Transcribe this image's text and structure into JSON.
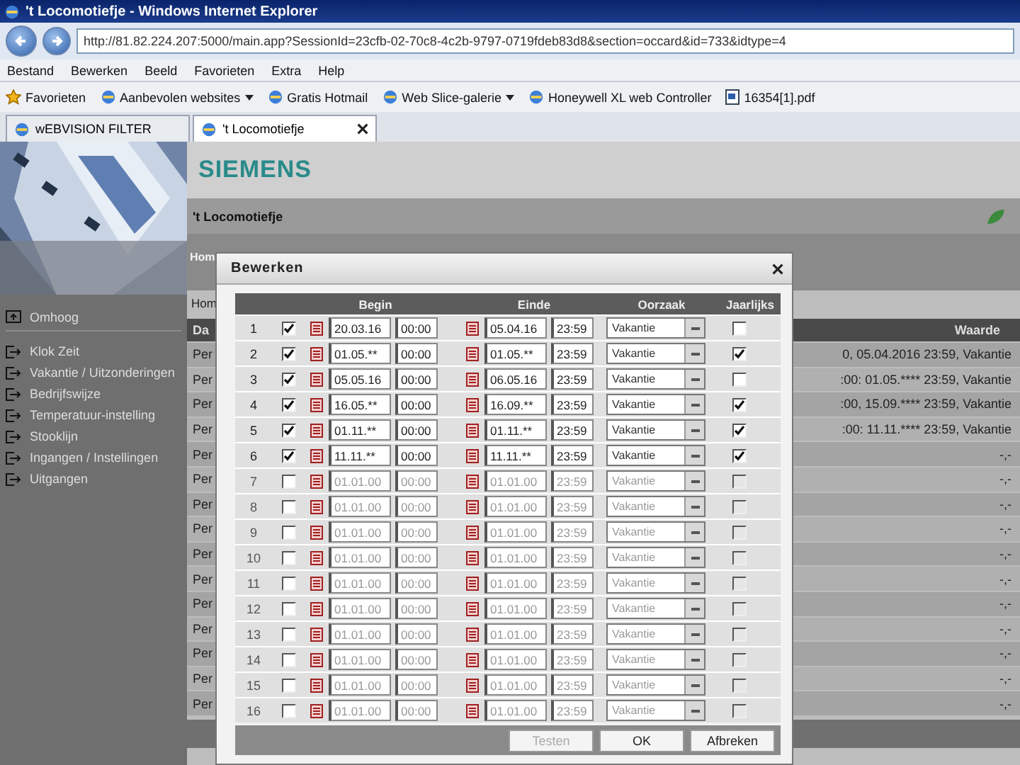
{
  "window": {
    "title": "'t Locomotiefje - Windows Internet Explorer"
  },
  "address": {
    "url": "http://81.82.224.207:5000/main.app?SessionId=23cfb-02-70c8-4c2b-9797-0719fdeb83d8&section=occard&id=733&idtype=4"
  },
  "menu": [
    "Bestand",
    "Bewerken",
    "Beeld",
    "Favorieten",
    "Extra",
    "Help"
  ],
  "favorites": {
    "label": "Favorieten",
    "links": [
      {
        "label": "Aanbevolen websites",
        "dropdown": true
      },
      {
        "label": "Gratis Hotmail",
        "dropdown": false
      },
      {
        "label": "Web Slice-galerie",
        "dropdown": true
      },
      {
        "label": "Honeywell XL web Controller",
        "dropdown": false
      },
      {
        "label": "16354[1].pdf",
        "dropdown": false
      }
    ]
  },
  "tabs": [
    {
      "label": "wEBVISION FILTER",
      "selected": false
    },
    {
      "label": "'t Locomotiefje",
      "selected": true
    }
  ],
  "page": {
    "logo": "SIEMENS",
    "site_title": "'t Locomotiefje",
    "breadcrumb": "Hom",
    "heading": "Hom",
    "sidebar": [
      {
        "kind": "up",
        "label": "Omhoog"
      },
      {
        "kind": "link",
        "label": "Klok Zeit"
      },
      {
        "kind": "link",
        "label": "Vakantie / Uitzonderingen"
      },
      {
        "kind": "link",
        "label": "Bedrijfswijze"
      },
      {
        "kind": "link",
        "label": "Temperatuur-instelling"
      },
      {
        "kind": "link",
        "label": "Stooklijn"
      },
      {
        "kind": "link",
        "label": "Ingangen / Instellingen"
      },
      {
        "kind": "link",
        "label": "Uitgangen"
      }
    ],
    "table": {
      "columns": [
        "Da",
        "Waarde"
      ],
      "rows": [
        {
          "column_1": "Per",
          "waarde": "0, 05.04.2016 23:59, Vakantie"
        },
        {
          "column_1": "Per",
          "waarde": ":00: 01.05.**** 23:59, Vakantie"
        },
        {
          "column_1": "Per",
          "waarde": ":00, 15.09.**** 23:59, Vakantie"
        },
        {
          "column_1": "Per",
          "waarde": ":00: 11.11.**** 23:59, Vakantie"
        },
        {
          "column_1": "Per",
          "waarde": "-,-"
        },
        {
          "column_1": "Per",
          "waarde": "-,-"
        },
        {
          "column_1": "Per",
          "waarde": "-,-"
        },
        {
          "column_1": "Per",
          "waarde": "-,-"
        },
        {
          "column_1": "Per",
          "waarde": "-,-"
        },
        {
          "column_1": "Per",
          "waarde": "-,-"
        },
        {
          "column_1": "Per",
          "waarde": "-,-"
        },
        {
          "column_1": "Per",
          "waarde": "-,-"
        },
        {
          "column_1": "Per",
          "waarde": "-,-"
        },
        {
          "column_1": "Per",
          "waarde": "-,-"
        },
        {
          "column_1": "Per",
          "waarde": "-,-"
        }
      ]
    }
  },
  "dialog": {
    "title": "Bewerken",
    "columns": [
      "Begin",
      "Einde",
      "Oorzaak",
      "Jaarlijks"
    ],
    "rows": [
      {
        "number": "1",
        "active": true,
        "begin_date": "20.03.16",
        "begin_time": "00:00",
        "end_date": "05.04.16",
        "end_time": "23:59",
        "reason": "Vakantie",
        "yearly": false
      },
      {
        "number": "2",
        "active": true,
        "begin_date": "01.05.**",
        "begin_time": "00:00",
        "end_date": "01.05.**",
        "end_time": "23:59",
        "reason": "Vakantie",
        "yearly": true
      },
      {
        "number": "3",
        "active": true,
        "begin_date": "05.05.16",
        "begin_time": "00:00",
        "end_date": "06.05.16",
        "end_time": "23:59",
        "reason": "Vakantie",
        "yearly": false
      },
      {
        "number": "4",
        "active": true,
        "begin_date": "16.05.**",
        "begin_time": "00:00",
        "end_date": "16.09.**",
        "end_time": "23:59",
        "reason": "Vakantie",
        "yearly": true
      },
      {
        "number": "5",
        "active": true,
        "begin_date": "01.11.**",
        "begin_time": "00:00",
        "end_date": "01.11.**",
        "end_time": "23:59",
        "reason": "Vakantie",
        "yearly": true
      },
      {
        "number": "6",
        "active": true,
        "begin_date": "11.11.**",
        "begin_time": "00:00",
        "end_date": "11.11.**",
        "end_time": "23:59",
        "reason": "Vakantie",
        "yearly": true
      },
      {
        "number": "7",
        "active": false,
        "begin_date": "01.01.00",
        "begin_time": "00:00",
        "end_date": "01.01.00",
        "end_time": "23:59",
        "reason": "Vakantie",
        "yearly": false
      },
      {
        "number": "8",
        "active": false,
        "begin_date": "01.01.00",
        "begin_time": "00:00",
        "end_date": "01.01.00",
        "end_time": "23:59",
        "reason": "Vakantie",
        "yearly": false
      },
      {
        "number": "9",
        "active": false,
        "begin_date": "01.01.00",
        "begin_time": "00:00",
        "end_date": "01.01.00",
        "end_time": "23:59",
        "reason": "Vakantie",
        "yearly": false
      },
      {
        "number": "10",
        "active": false,
        "begin_date": "01.01.00",
        "begin_time": "00:00",
        "end_date": "01.01.00",
        "end_time": "23:59",
        "reason": "Vakantie",
        "yearly": false
      },
      {
        "number": "11",
        "active": false,
        "begin_date": "01.01.00",
        "begin_time": "00:00",
        "end_date": "01.01.00",
        "end_time": "23:59",
        "reason": "Vakantie",
        "yearly": false
      },
      {
        "number": "12",
        "active": false,
        "begin_date": "01.01.00",
        "begin_time": "00:00",
        "end_date": "01.01.00",
        "end_time": "23:59",
        "reason": "Vakantie",
        "yearly": false
      },
      {
        "number": "13",
        "active": false,
        "begin_date": "01.01.00",
        "begin_time": "00:00",
        "end_date": "01.01.00",
        "end_time": "23:59",
        "reason": "Vakantie",
        "yearly": false
      },
      {
        "number": "14",
        "active": false,
        "begin_date": "01.01.00",
        "begin_time": "00:00",
        "end_date": "01.01.00",
        "end_time": "23:59",
        "reason": "Vakantie",
        "yearly": false
      },
      {
        "number": "15",
        "active": false,
        "begin_date": "01.01.00",
        "begin_time": "00:00",
        "end_date": "01.01.00",
        "end_time": "23:59",
        "reason": "Vakantie",
        "yearly": false
      },
      {
        "number": "16",
        "active": false,
        "begin_date": "01.01.00",
        "begin_time": "00:00",
        "end_date": "01.01.00",
        "end_time": "23:59",
        "reason": "Vakantie",
        "yearly": false
      }
    ],
    "buttons": [
      {
        "label": "Testen",
        "disabled": true
      },
      {
        "label": "OK",
        "disabled": false
      },
      {
        "label": "Afbreken",
        "disabled": false
      }
    ]
  }
}
